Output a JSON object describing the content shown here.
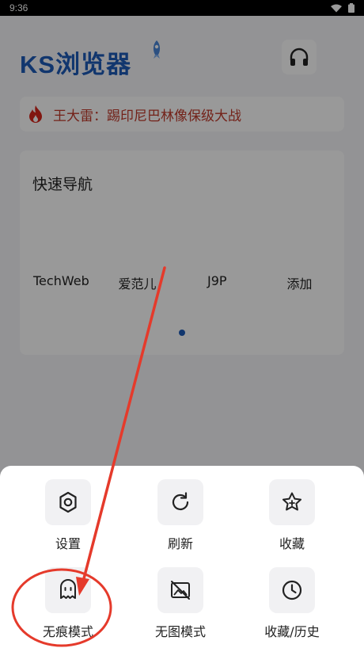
{
  "status_bar": {
    "time": "9:36"
  },
  "header": {
    "logo_text": "KS浏览器"
  },
  "hot_news": {
    "text": "王大雷：踢印尼巴林像保级大战"
  },
  "quick_nav": {
    "title": "快速导航",
    "items": [
      {
        "label": "TechWeb"
      },
      {
        "label": "爱范儿"
      },
      {
        "label": "J9P"
      },
      {
        "label": "添加"
      }
    ]
  },
  "menu": {
    "items": [
      {
        "label": "设置",
        "icon": "gear-icon"
      },
      {
        "label": "刷新",
        "icon": "refresh-icon"
      },
      {
        "label": "收藏",
        "icon": "star-icon"
      },
      {
        "label": "无痕模式",
        "icon": "incognito-ghost-icon"
      },
      {
        "label": "无图模式",
        "icon": "no-image-icon"
      },
      {
        "label": "收藏/历史",
        "icon": "clock-icon"
      }
    ]
  },
  "colors": {
    "brand": "#1d5ab8",
    "hot_text": "#c0392b",
    "annotation": "#e53a2b"
  }
}
